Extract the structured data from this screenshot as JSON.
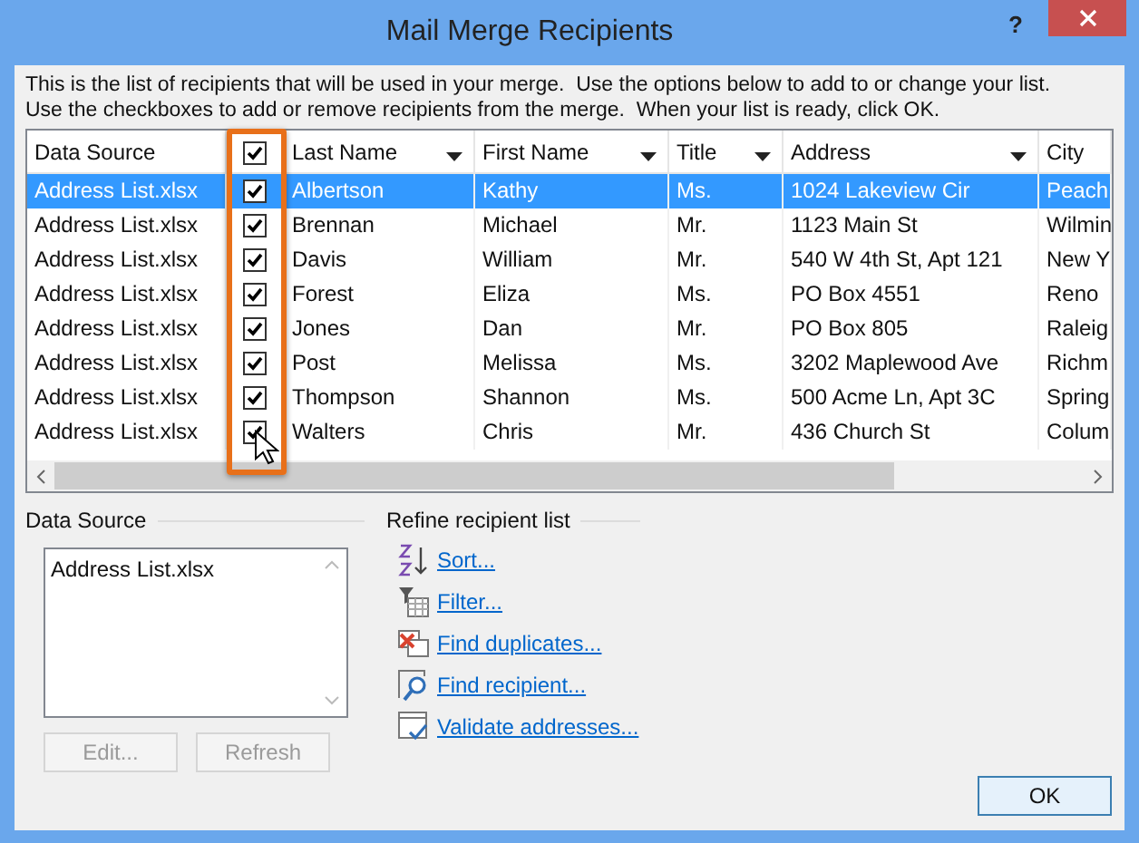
{
  "window": {
    "title": "Mail Merge Recipients",
    "help": "?"
  },
  "instructions": [
    "This is the list of recipients that will be used in your merge.  Use the options below to add to or change your list.",
    "Use the checkboxes to add or remove recipients from the merge.  When your list is ready, click OK."
  ],
  "table": {
    "columns": [
      {
        "label": "Data Source",
        "kind": "text",
        "sort": false
      },
      {
        "kind": "check",
        "checked": true
      },
      {
        "label": "Last Name",
        "kind": "text",
        "sort": true
      },
      {
        "label": "First Name",
        "kind": "text",
        "sort": true
      },
      {
        "label": "Title",
        "kind": "text",
        "sort": true
      },
      {
        "label": "Address",
        "kind": "text",
        "sort": true
      },
      {
        "label": "City",
        "kind": "text",
        "sort": false
      }
    ],
    "rows": [
      {
        "selected": true,
        "checked": true,
        "cells": [
          "Address List.xlsx",
          "",
          "Albertson",
          "Kathy",
          "Ms.",
          "1024 Lakeview Cir",
          "Peach"
        ]
      },
      {
        "selected": false,
        "checked": true,
        "cells": [
          "Address List.xlsx",
          "",
          "Brennan",
          "Michael",
          "Mr.",
          "1123 Main St",
          "Wilmin"
        ]
      },
      {
        "selected": false,
        "checked": true,
        "cells": [
          "Address List.xlsx",
          "",
          "Davis",
          "William",
          "Mr.",
          "540 W 4th St, Apt 121",
          "New Y"
        ]
      },
      {
        "selected": false,
        "checked": true,
        "cells": [
          "Address List.xlsx",
          "",
          "Forest",
          "Eliza",
          "Ms.",
          "PO Box 4551",
          "Reno"
        ]
      },
      {
        "selected": false,
        "checked": true,
        "cells": [
          "Address List.xlsx",
          "",
          "Jones",
          "Dan",
          "Mr.",
          "PO Box 805",
          "Raleig"
        ]
      },
      {
        "selected": false,
        "checked": true,
        "cells": [
          "Address List.xlsx",
          "",
          "Post",
          "Melissa",
          "Ms.",
          "3202 Maplewood Ave",
          "Richm"
        ]
      },
      {
        "selected": false,
        "checked": true,
        "cells": [
          "Address List.xlsx",
          "",
          "Thompson",
          "Shannon",
          "Ms.",
          "500 Acme Ln, Apt 3C",
          "Spring"
        ]
      },
      {
        "selected": false,
        "checked": true,
        "cells": [
          "Address List.xlsx",
          "",
          "Walters",
          "Chris",
          "Mr.",
          "436 Church St",
          "Colum"
        ]
      }
    ]
  },
  "data_source": {
    "label": "Data Source",
    "items": [
      "Address List.xlsx"
    ],
    "buttons": [
      {
        "label": "Edit...",
        "disabled": true
      },
      {
        "label": "Refresh",
        "disabled": true
      }
    ]
  },
  "refine": {
    "label": "Refine recipient list",
    "links": [
      {
        "label": "Sort...",
        "kind": "sort"
      },
      {
        "label": "Filter...",
        "kind": "filter"
      },
      {
        "label": "Find duplicates...",
        "kind": "duplicates"
      },
      {
        "label": "Find recipient...",
        "kind": "find"
      },
      {
        "label": "Validate addresses...",
        "kind": "validate"
      }
    ]
  },
  "buttons": [
    {
      "label": "OK"
    }
  ]
}
